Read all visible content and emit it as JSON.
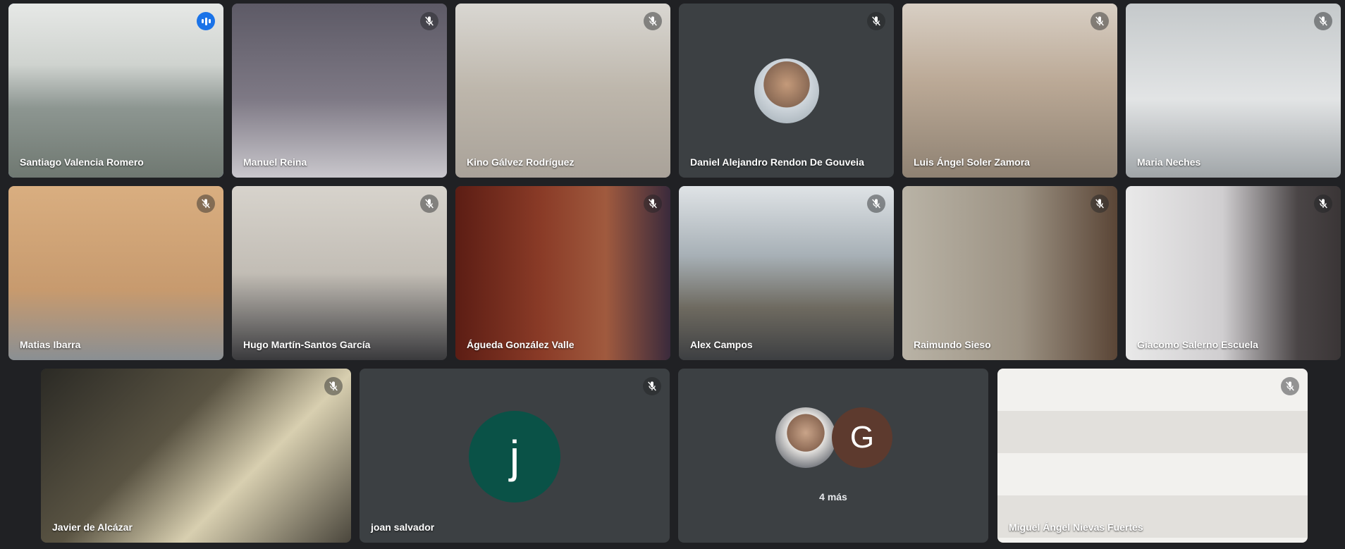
{
  "participants": [
    {
      "name": "Santiago Valencia Romero",
      "mic": "speaking",
      "bg": "#9aa39b"
    },
    {
      "name": "Manuel Reina",
      "mic": "muted",
      "bg": "#6b6670"
    },
    {
      "name": "Kino Gálvez Rodríguez",
      "mic": "muted",
      "bg": "#b8b2aa"
    },
    {
      "name": "Daniel Alejandro Rendon De Gouveia",
      "mic": "muted",
      "bg": "#3c4043"
    },
    {
      "name": "Luis Ángel Soler Zamora",
      "mic": "muted",
      "bg": "#a89a8c"
    },
    {
      "name": "Maria Neches",
      "mic": "muted",
      "bg": "#b9bec0"
    },
    {
      "name": "Matias Ibarra",
      "mic": "muted",
      "bg": "#c79a6e"
    },
    {
      "name": "Hugo Martín-Santos García",
      "mic": "muted",
      "bg": "#c8c4bd"
    },
    {
      "name": "Águeda González Valle",
      "mic": "muted",
      "bg": "#6e2a1f"
    },
    {
      "name": "Alex Campos",
      "mic": "muted",
      "bg": "#7a8690"
    },
    {
      "name": "Raimundo Sieso",
      "mic": "muted",
      "bg": "#8c8578"
    },
    {
      "name": "Giacomo Salerno Escuela",
      "mic": "muted",
      "bg": "#9d9892"
    },
    {
      "name": "Javier de Alcázar",
      "mic": "muted",
      "bg": "#4f4a3d"
    },
    {
      "name": "joan salvador",
      "mic": "muted",
      "bg": "#3c4043",
      "initial": "j",
      "avatar_color": "#0a5247"
    },
    {
      "name": "Miguel Ángel Nievas Fuertes",
      "mic": "muted",
      "bg": "#d6d4d0"
    }
  ],
  "group_tile": {
    "initial": "G",
    "avatar_color": "#5d3a2e",
    "more_label": "4 más"
  },
  "colors": {
    "background": "#202124",
    "tile": "#3c4043",
    "active_border": "#8ab4f8",
    "speaking": "#1a73e8"
  }
}
